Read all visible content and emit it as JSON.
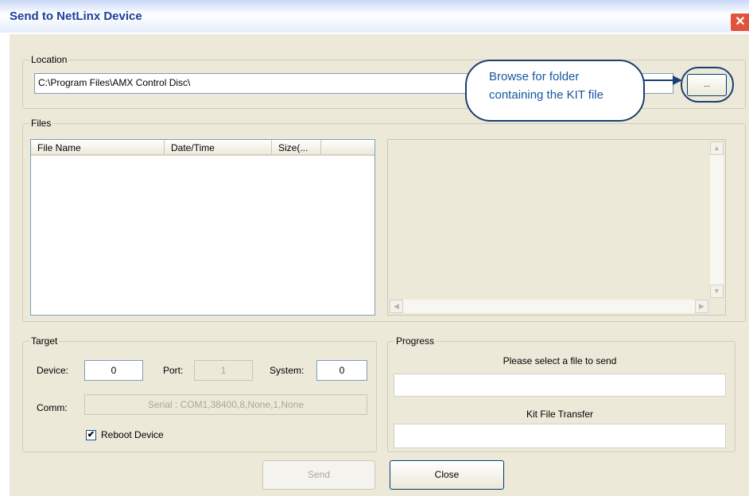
{
  "window": {
    "title": "Send to NetLinx Device",
    "close_glyph": "✕"
  },
  "location": {
    "legend": "Location",
    "path": "C:\\Program Files\\AMX Control Disc\\",
    "browse_label": "..."
  },
  "callout": {
    "line1": "Browse for folder",
    "line2": "containing the KIT file"
  },
  "files": {
    "legend": "Files",
    "columns": [
      "File Name",
      "Date/Time",
      "Size(..."
    ],
    "rows": []
  },
  "scroll_icons": {
    "up": "▲",
    "down": "▼",
    "left": "◀",
    "right": "▶"
  },
  "target": {
    "legend": "Target",
    "device_label": "Device:",
    "device_value": "0",
    "port_label": "Port:",
    "port_value": "1",
    "system_label": "System:",
    "system_value": "0",
    "comm_label": "Comm:",
    "comm_value": "Serial : COM1,38400,8,None,1,None",
    "reboot_label": "Reboot Device",
    "reboot_checked": "✔"
  },
  "progress": {
    "legend": "Progress",
    "status_text": "Please select a file to send",
    "kit_label": "Kit File Transfer"
  },
  "buttons": {
    "send": "Send",
    "close": "Close"
  },
  "colors": {
    "accent": "#1757a0",
    "dialog_bg": "#ece9d8",
    "close_red": "#e1533c"
  }
}
